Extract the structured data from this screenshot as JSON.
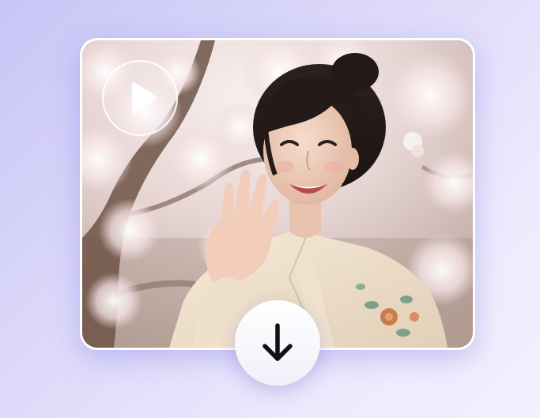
{
  "preview": {
    "image_alt": "",
    "play_icon": "play-icon",
    "download_icon": "arrow-down-icon"
  },
  "colors": {
    "background_start": "#c9c5f6",
    "background_end": "#f3f1fe",
    "card": "#ffffff",
    "icon_dark": "#111111"
  }
}
